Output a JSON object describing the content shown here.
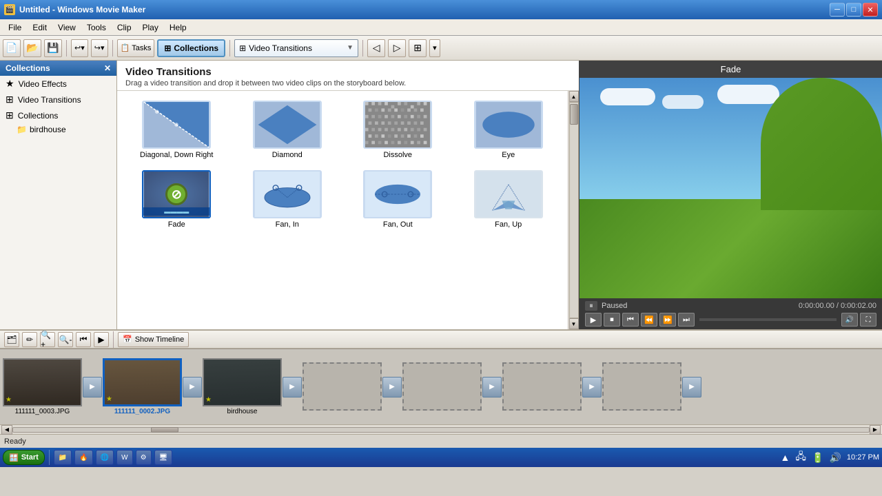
{
  "window": {
    "title": "Untitled - Windows Movie Maker",
    "icon": "🎬"
  },
  "titlebar_buttons": {
    "minimize": "─",
    "maximize": "□",
    "close": "✕"
  },
  "menubar": {
    "items": [
      "File",
      "Edit",
      "View",
      "Tools",
      "Clip",
      "Play",
      "Help"
    ]
  },
  "toolbar": {
    "new_label": "New",
    "open_label": "Open",
    "save_label": "Save",
    "undo_label": "↩",
    "redo_label": "↪",
    "tasks_label": "Tasks",
    "collections_label": "Collections",
    "dropdown_label": "Video Transitions",
    "view_icon": "⊞"
  },
  "left_panel": {
    "title": "Collections",
    "items": [
      {
        "label": "Video Effects",
        "icon": "★"
      },
      {
        "label": "Video Transitions",
        "icon": "⊞"
      },
      {
        "label": "Collections",
        "icon": "⊞"
      },
      {
        "label": "birdhouse",
        "icon": "📁",
        "indent": true
      }
    ]
  },
  "content": {
    "title": "Video Transitions",
    "subtitle": "Drag a video transition and drop it between two video clips on the storyboard below.",
    "transitions": [
      {
        "id": "diagonal-down-right",
        "label": "Diagonal, Down Right",
        "type": "diagonal"
      },
      {
        "id": "diamond",
        "label": "Diamond",
        "type": "diamond"
      },
      {
        "id": "dissolve",
        "label": "Dissolve",
        "type": "dissolve"
      },
      {
        "id": "eye",
        "label": "Eye",
        "type": "eye"
      },
      {
        "id": "fade",
        "label": "Fade",
        "type": "fade",
        "selected": true
      },
      {
        "id": "fan-in",
        "label": "Fan, In",
        "type": "fan-in"
      },
      {
        "id": "fan-out",
        "label": "Fan, Out",
        "type": "fan-out"
      },
      {
        "id": "fan-up",
        "label": "Fan, Up",
        "type": "fan-up"
      }
    ]
  },
  "preview": {
    "title": "Fade",
    "status": "Paused",
    "time_current": "0:00:00.00",
    "time_total": "0:00:02.00"
  },
  "storyboard": {
    "show_timeline_label": "Show Timeline",
    "clips": [
      {
        "id": "clip1",
        "label": "111111_0003.JPG",
        "selected": false
      },
      {
        "id": "clip2",
        "label": "111111_0002.JPG",
        "selected": true
      },
      {
        "id": "clip3",
        "label": "birdhouse",
        "selected": false
      }
    ]
  },
  "statusbar": {
    "text": "Ready"
  },
  "taskbar": {
    "start_label": "Start",
    "apps": [
      {
        "label": "📁"
      },
      {
        "label": "🔥"
      },
      {
        "label": "📘"
      },
      {
        "label": "W"
      },
      {
        "label": "🔧"
      },
      {
        "label": "🖥"
      }
    ],
    "time": "10:27 PM",
    "tray_icons": [
      "▲",
      "🔊"
    ]
  }
}
